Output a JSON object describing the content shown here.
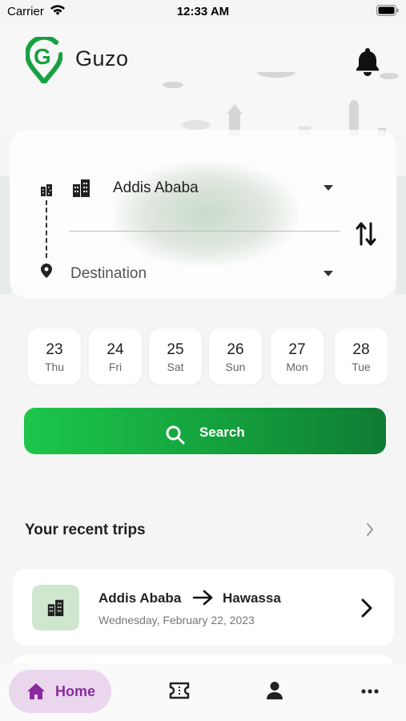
{
  "status_bar": {
    "carrier": "Carrier",
    "time": "12:33 AM"
  },
  "header": {
    "app_name": "Guzo",
    "logo_icon": "guzo-logo-pin",
    "notification_icon": "bell-icon"
  },
  "search_form": {
    "origin_value": "Addis Ababa",
    "destination_placeholder": "Destination",
    "swap_icon": "swap-vertical-icon"
  },
  "dates": [
    {
      "day": "23",
      "weekday": "Thu"
    },
    {
      "day": "24",
      "weekday": "Fri"
    },
    {
      "day": "25",
      "weekday": "Sat"
    },
    {
      "day": "26",
      "weekday": "Sun"
    },
    {
      "day": "27",
      "weekday": "Mon"
    },
    {
      "day": "28",
      "weekday": "Tue"
    }
  ],
  "search_button": {
    "label": "Search"
  },
  "recent": {
    "title": "Your recent trips",
    "trips": [
      {
        "from": "Addis Ababa",
        "to": "Hawassa",
        "date": "Wednesday, February 22, 2023"
      }
    ]
  },
  "tabbar": {
    "home_label": "Home",
    "items": [
      "home-icon",
      "ticket-icon",
      "profile-icon",
      "more-icon"
    ]
  },
  "colors": {
    "brand_green": "#14a03d",
    "active_tab_bg": "#ead7ee",
    "active_tab_fg": "#8b2aa0",
    "trip_icon_bg": "#cfe6cf"
  }
}
